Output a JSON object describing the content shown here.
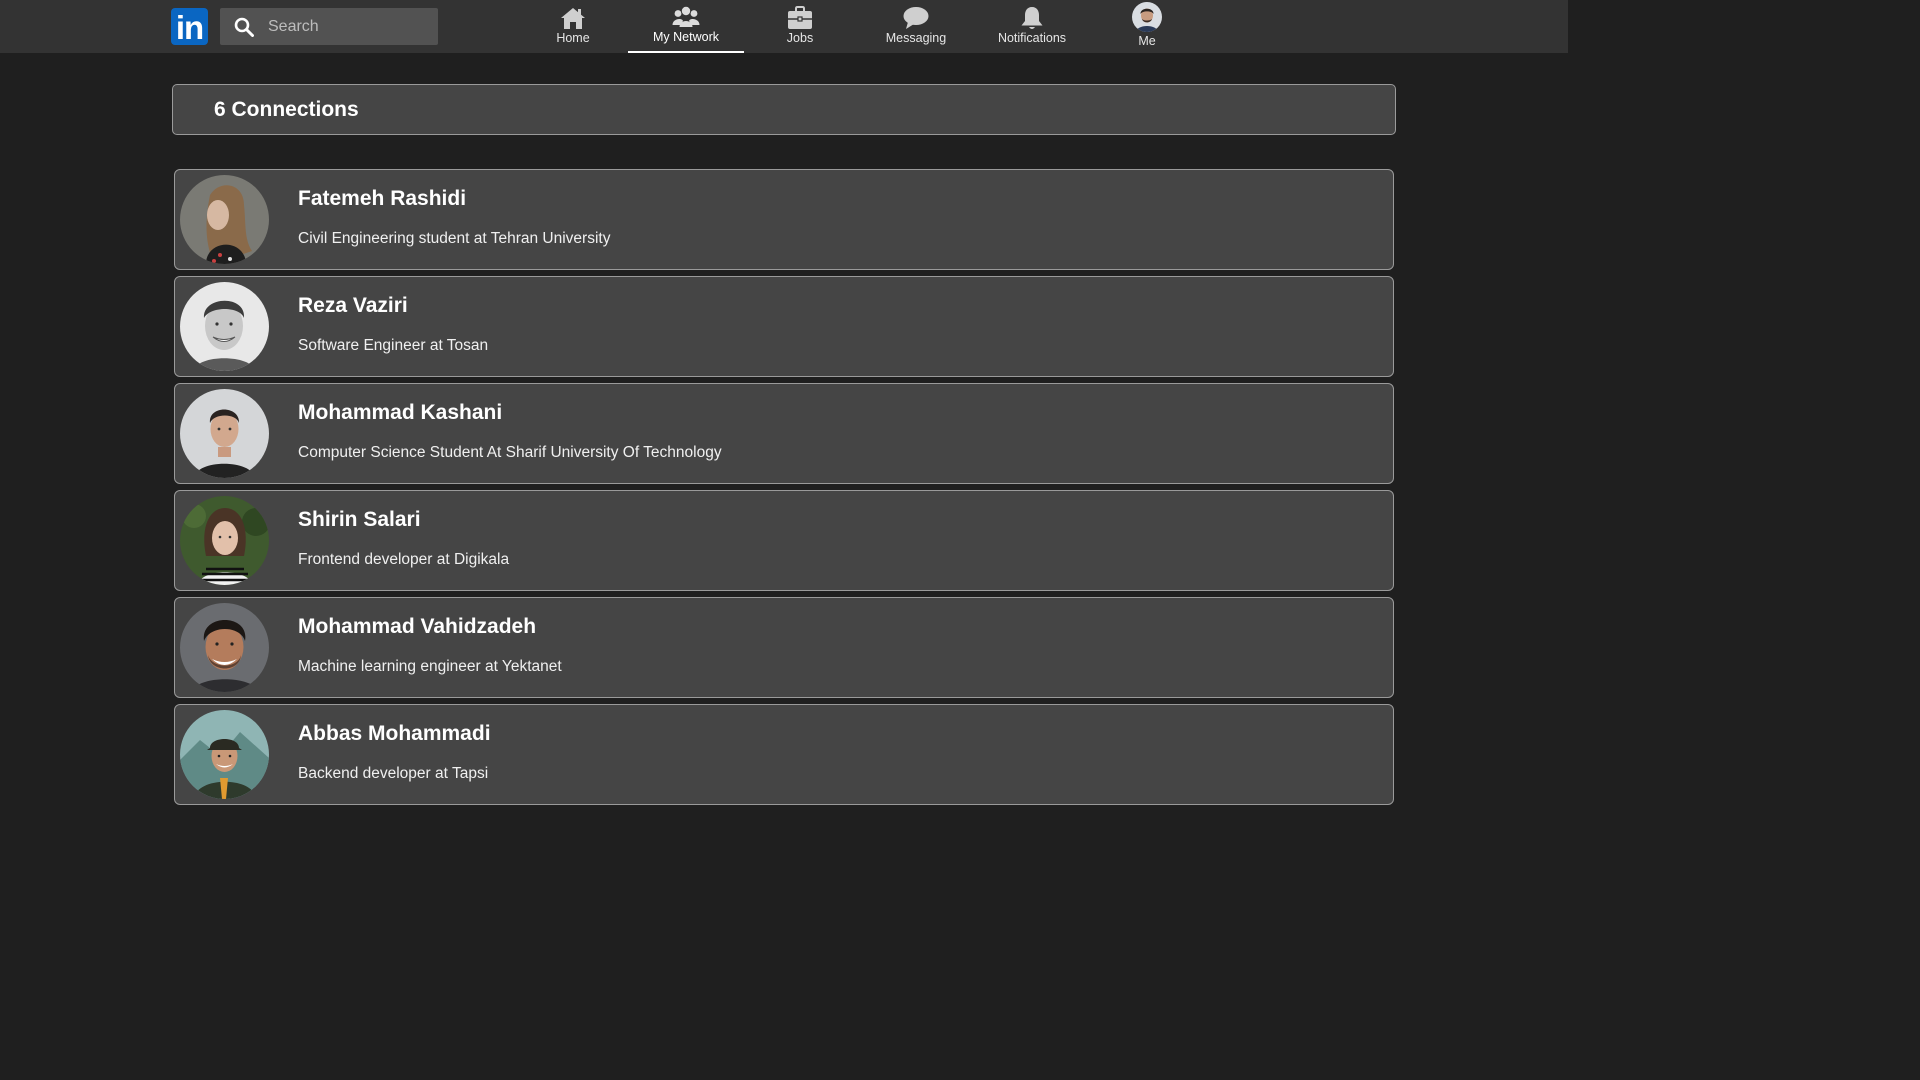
{
  "header": {
    "logo_text": "in",
    "brand_color": "#0a66c2",
    "search": {
      "placeholder": "Search",
      "value": ""
    },
    "nav": [
      {
        "label": "Home",
        "icon": "home-icon",
        "active": false
      },
      {
        "label": "My Network",
        "icon": "network-icon",
        "active": true
      },
      {
        "label": "Jobs",
        "icon": "briefcase-icon",
        "active": false
      },
      {
        "label": "Messaging",
        "icon": "chat-icon",
        "active": false
      },
      {
        "label": "Notifications",
        "icon": "bell-icon",
        "active": false
      },
      {
        "label": "Me",
        "icon": "avatar",
        "active": false
      }
    ]
  },
  "main": {
    "connections_title": "6 Connections",
    "connections": [
      {
        "name": "Fatemeh Rashidi",
        "headline": "Civil Engineering student at Tehran University"
      },
      {
        "name": "Reza Vaziri",
        "headline": "Software Engineer at Tosan"
      },
      {
        "name": "Mohammad Kashani",
        "headline": "Computer Science Student At Sharif University Of Technology"
      },
      {
        "name": "Shirin Salari",
        "headline": "Frontend developer at Digikala"
      },
      {
        "name": "Mohammad Vahidzadeh",
        "headline": "Machine learning engineer at Yektanet"
      },
      {
        "name": "Abbas Mohammadi",
        "headline": "Backend developer at Tapsi"
      }
    ]
  }
}
